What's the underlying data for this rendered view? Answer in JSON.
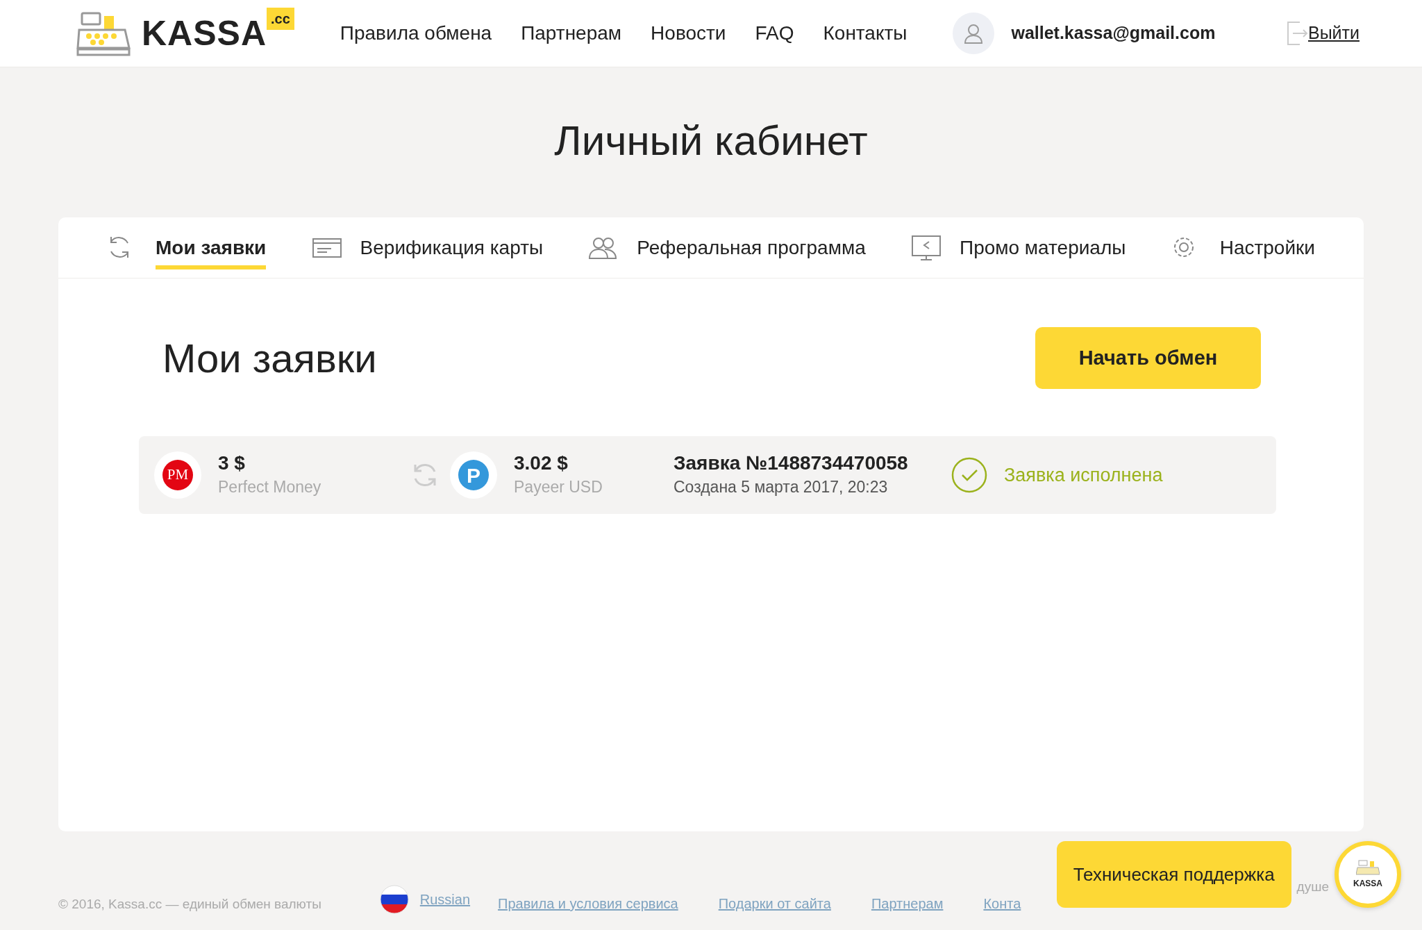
{
  "header": {
    "logo": {
      "name": "KASSA",
      "badge": ".cc"
    },
    "nav": [
      "Правила обмена",
      "Партнерам",
      "Новости",
      "FAQ",
      "Контакты"
    ],
    "user": {
      "email": "wallet.kassa@gmail.com"
    },
    "logout": "Выйти"
  },
  "page_title": "Личный кабинет",
  "tabs": [
    {
      "label": "Мои заявки",
      "selected": true
    },
    {
      "label": "Верификация карты",
      "selected": false
    },
    {
      "label": "Реферальная программа",
      "selected": false
    },
    {
      "label": "Промо материалы",
      "selected": false
    },
    {
      "label": "Настройки",
      "selected": false
    }
  ],
  "section": {
    "title": "Мои заявки",
    "button": "Начать обмен"
  },
  "orders": [
    {
      "from": {
        "logo": "PM",
        "kind": "pm",
        "amount": "3 $",
        "system": "Perfect Money"
      },
      "to": {
        "logo": "P",
        "kind": "payeer",
        "amount": "3.02 $",
        "system": "Payeer USD"
      },
      "number": "Заявка №1488734470058",
      "created": "Создана 5 марта 2017, 20:23",
      "status": {
        "text": "Заявка исполнена",
        "completed": true
      }
    }
  ],
  "footer": {
    "copyright": "© 2016, Kassa.cc — единый обмен валюты",
    "language": "Russian",
    "links": [
      "Правила и условия сервиса",
      "Подарки от сайта",
      "Партнерам",
      "Конта"
    ],
    "fragment": "душе"
  },
  "support": {
    "label": "Техническая поддержка",
    "logo": "KASSA"
  }
}
